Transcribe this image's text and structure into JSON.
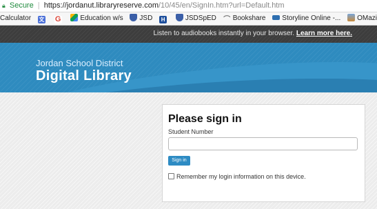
{
  "browser": {
    "secure_label": "Secure",
    "url_host": "https://jordanut.libraryreserve.com",
    "url_path": "/10/45/en/SignIn.htm?url=Default.htm",
    "lock_color": "#1e8a3c"
  },
  "bookmarks": [
    {
      "label": "Calculator",
      "icon": "calculator-icon"
    },
    {
      "label": "",
      "icon": "translate-icon"
    },
    {
      "label": "",
      "icon": "google-icon"
    },
    {
      "label": "Education w/s",
      "icon": "drive-icon"
    },
    {
      "label": "JSD",
      "icon": "shield-icon"
    },
    {
      "label": "",
      "icon": "h-icon"
    },
    {
      "label": "JSDSpED",
      "icon": "shield-icon"
    },
    {
      "label": "Bookshare",
      "icon": "bookshare-icon"
    },
    {
      "label": "Storyline Online -...",
      "icon": "storyline-icon"
    },
    {
      "label": "OMazing Kids",
      "icon": "omazing-icon"
    }
  ],
  "header": {
    "message": "Listen to audiobooks instantly in your browser.",
    "learn_more": "Learn more here."
  },
  "banner": {
    "district": "Jordan School District",
    "library": "Digital Library",
    "color": "#2e8bbf"
  },
  "signin": {
    "title": "Please sign in",
    "field_label": "Student Number",
    "field_value": "",
    "button_label": "Sign in",
    "button_color": "#2d8bc3",
    "remember_label": "Remember my login information on this device.",
    "remember_checked": false
  }
}
